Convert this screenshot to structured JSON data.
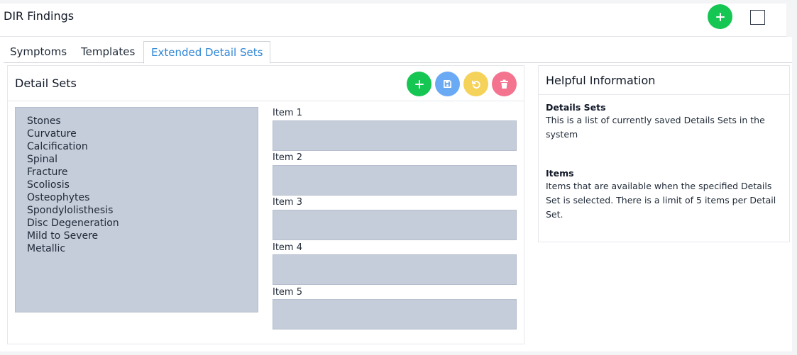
{
  "header": {
    "title": "DIR Findings"
  },
  "tabs": [
    {
      "label": "Symptoms"
    },
    {
      "label": "Templates"
    },
    {
      "label": "Extended Detail Sets"
    }
  ],
  "detail_sets": {
    "title": "Detail Sets",
    "sets": [
      "Stones",
      "Curvature",
      "Calcification",
      "Spinal",
      "Fracture",
      "Scoliosis",
      "Osteophytes",
      "Spondylolisthesis",
      "Disc Degeneration",
      "Mild to Severe",
      "Metallic"
    ],
    "items": [
      {
        "label": "Item 1",
        "value": ""
      },
      {
        "label": "Item 2",
        "value": ""
      },
      {
        "label": "Item 3",
        "value": ""
      },
      {
        "label": "Item 4",
        "value": ""
      },
      {
        "label": "Item 5",
        "value": ""
      }
    ]
  },
  "help": {
    "title": "Helpful Information",
    "sections": [
      {
        "heading": "Details Sets",
        "text": "This is a list of currently saved Details Sets in the system"
      },
      {
        "heading": "Items",
        "text": "Items that are available when the specified Details Set is selected. There is a limit of 5 items per Detail Set."
      }
    ]
  },
  "colors": {
    "add": "#16c653",
    "save": "#6aa9f4",
    "undo": "#f5d25a",
    "delete": "#f4738f",
    "active_tab": "#2f86d6"
  },
  "icons": [
    "plus-icon",
    "save-icon",
    "undo-icon",
    "trash-icon"
  ]
}
